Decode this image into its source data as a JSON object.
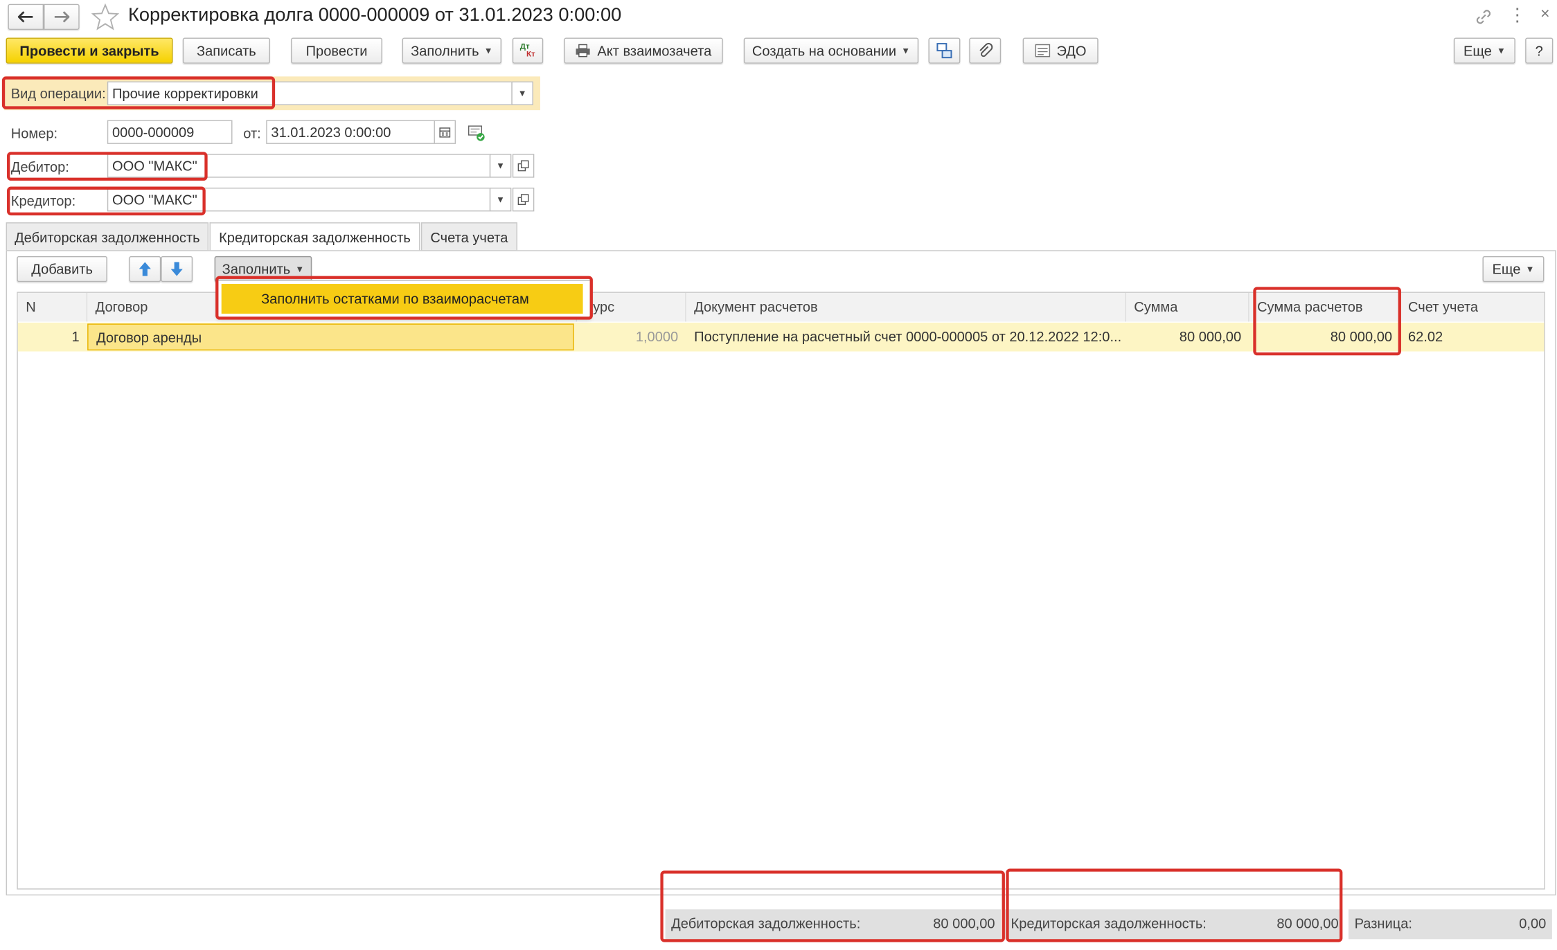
{
  "window": {
    "title": "Корректировка долга 0000-000009 от 31.01.2023 0:00:00"
  },
  "toolbar": {
    "post_close": "Провести и закрыть",
    "write": "Записать",
    "post": "Провести",
    "fill": "Заполнить",
    "dtkt_top": "Дт",
    "dtkt_bottom": "Кт",
    "act": "Акт взаимозачета",
    "create_based": "Создать на основании",
    "edo": "ЭДО",
    "more": "Еще",
    "help": "?"
  },
  "header": {
    "operation_label": "Вид операции:",
    "operation_value": "Прочие корректировки",
    "number_label": "Номер:",
    "number_value": "0000-000009",
    "date_label": "от:",
    "date_value": "31.01.2023  0:00:00",
    "debtor_label": "Дебитор:",
    "debtor_value": "ООО \"МАКС\"",
    "creditor_label": "Кредитор:",
    "creditor_value": "ООО \"МАКС\""
  },
  "tabs": [
    {
      "label": "Дебиторская задолженность"
    },
    {
      "label": "Кредиторская задолженность"
    },
    {
      "label": "Счета учета"
    }
  ],
  "table_toolbar": {
    "add": "Добавить",
    "fill": "Заполнить",
    "more": "Еще",
    "fill_menu_item": "Заполнить остатками по взаиморасчетам"
  },
  "table": {
    "columns": [
      "N",
      "Договор",
      "Курс",
      "Документ расчетов",
      "Сумма",
      "Сумма расчетов",
      "Счет учета"
    ],
    "rows": [
      {
        "n": "1",
        "contract": "Договор аренды",
        "rate": "1,0000",
        "document": "Поступление на расчетный счет 0000-000005 от 20.12.2022 12:0...",
        "amount": "80 000,00",
        "settlement_amount": "80 000,00",
        "account": "62.02"
      }
    ]
  },
  "footer": {
    "receivable_label": "Дебиторская задолженность:",
    "receivable_value": "80 000,00",
    "payable_label": "Кредиторская задолженность:",
    "payable_value": "80 000,00",
    "difference_label": "Разница:",
    "difference_value": "0,00"
  },
  "colors": {
    "accent_yellow": "#f5d100",
    "highlight_red": "#d9302a",
    "selected_row": "#fdf5c4"
  }
}
